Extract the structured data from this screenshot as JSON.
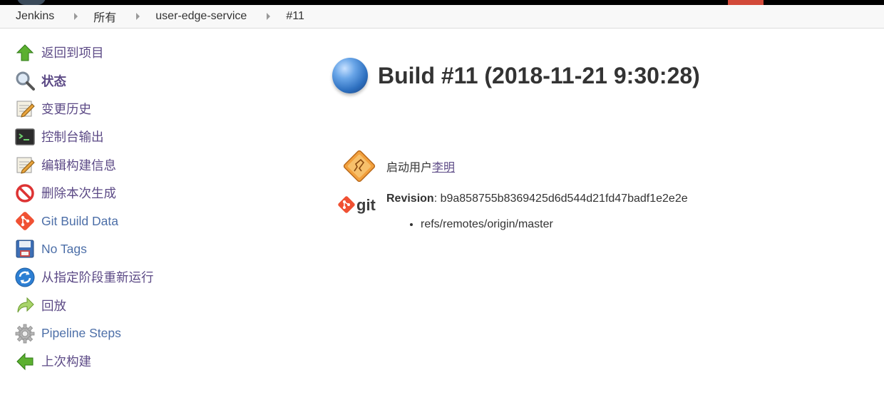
{
  "breadcrumb": {
    "items": [
      "Jenkins",
      "所有",
      "user-edge-service",
      "#11"
    ]
  },
  "sidebar": {
    "items": [
      {
        "label": "返回到项目",
        "icon": "arrow-up-icon"
      },
      {
        "label": "状态",
        "icon": "magnifier-icon"
      },
      {
        "label": "变更历史",
        "icon": "notepad-icon"
      },
      {
        "label": "控制台输出",
        "icon": "terminal-icon"
      },
      {
        "label": "编辑构建信息",
        "icon": "notepad-icon"
      },
      {
        "label": "删除本次生成",
        "icon": "no-entry-icon"
      },
      {
        "label": "Git Build Data",
        "icon": "git-icon"
      },
      {
        "label": "No Tags",
        "icon": "floppy-icon"
      },
      {
        "label": "从指定阶段重新运行",
        "icon": "refresh-icon"
      },
      {
        "label": "回放",
        "icon": "replay-arrow-icon"
      },
      {
        "label": "Pipeline Steps",
        "icon": "gear-icon"
      },
      {
        "label": "上次构建",
        "icon": "arrow-left-icon"
      }
    ]
  },
  "main": {
    "title": "Build #11 (2018-11-21 9:30:28)",
    "started_by_prefix": "启动用户",
    "started_by_user": "李明",
    "git_logo_text": "git",
    "revision_label": "Revision",
    "revision_value": ": b9a858755b8369425d6d544d21fd47badf1e2e2e",
    "refs": [
      "refs/remotes/origin/master"
    ]
  },
  "colors": {
    "link": "#4d6fa8",
    "visited_link": "#5c4a86",
    "git_brand": "#f05133",
    "topbar_red": "#d24939"
  }
}
